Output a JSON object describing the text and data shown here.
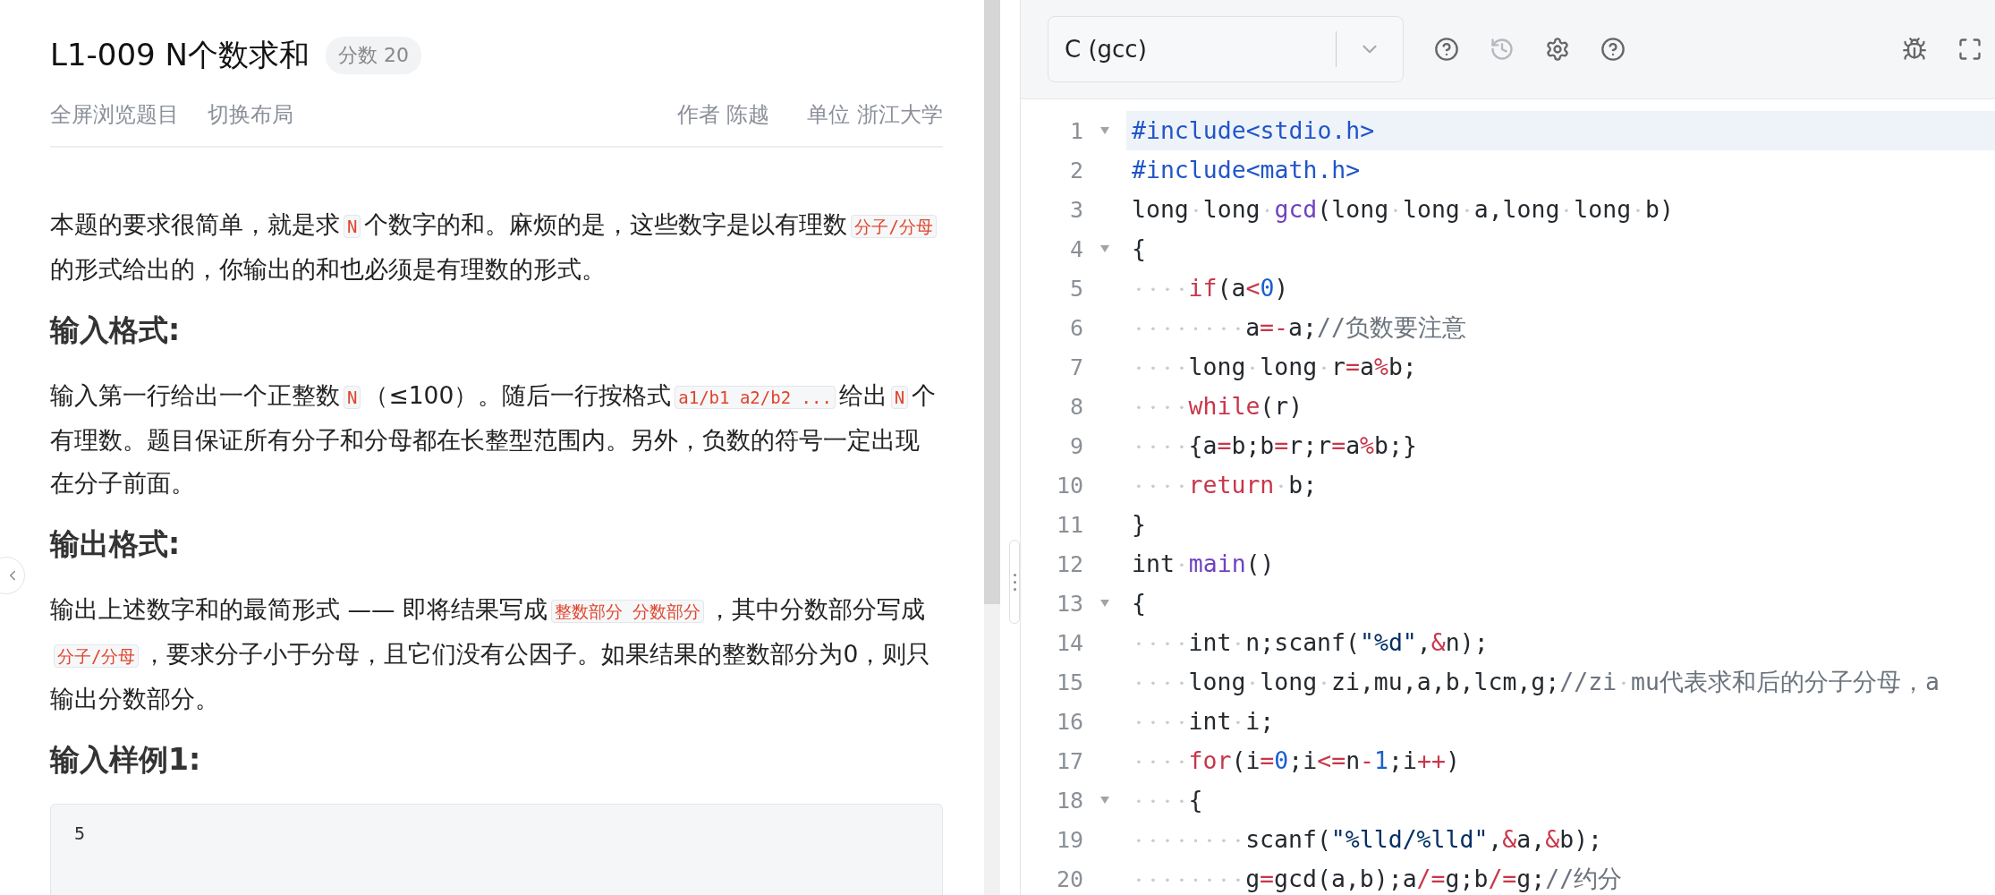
{
  "problem": {
    "title": "L1-009 N个数求和",
    "score_badge": "分数 20",
    "actions": [
      "全屏浏览题目",
      "切换布局"
    ],
    "meta": [
      "作者 陈越",
      "单位 浙江大学"
    ],
    "sections": [
      {
        "kind": "paragraph",
        "segments": [
          {
            "kind": "text",
            "text": "本题的要求很简单，就是求"
          },
          {
            "kind": "code",
            "text": "N"
          },
          {
            "kind": "text",
            "text": "个数字的和。麻烦的是，这些数字是以有理数"
          },
          {
            "kind": "code",
            "text": "分子/分母"
          },
          {
            "kind": "text",
            "text": "的形式给出的，你输出的和也必须是有理数的形式。"
          }
        ]
      },
      {
        "kind": "heading",
        "text": "输入格式:"
      },
      {
        "kind": "paragraph",
        "segments": [
          {
            "kind": "text",
            "text": "输入第一行给出一个正整数"
          },
          {
            "kind": "code",
            "text": "N"
          },
          {
            "kind": "text",
            "text": "（≤100）。随后一行按格式"
          },
          {
            "kind": "code",
            "text": "a1/b1 a2/b2 ..."
          },
          {
            "kind": "text",
            "text": "给出"
          },
          {
            "kind": "code",
            "text": "N"
          },
          {
            "kind": "text",
            "text": "个有理数。题目保证所有分子和分母都在长整型范围内。另外，负数的符号一定出现在分子前面。"
          }
        ]
      },
      {
        "kind": "heading",
        "text": "输出格式:"
      },
      {
        "kind": "paragraph",
        "segments": [
          {
            "kind": "text",
            "text": "输出上述数字和的最简形式 —— 即将结果写成"
          },
          {
            "kind": "code",
            "text": "整数部分 分数部分"
          },
          {
            "kind": "text",
            "text": "，其中分数部分写成"
          },
          {
            "kind": "code",
            "text": "分子/分母"
          },
          {
            "kind": "text",
            "text": "，要求分子小于分母，且它们没有公因子。如果结果的整数部分为0，则只输出分数部分。"
          }
        ]
      },
      {
        "kind": "heading",
        "text": "输入样例1:"
      },
      {
        "kind": "sample",
        "lines": [
          "5"
        ]
      }
    ]
  },
  "editor": {
    "language": "C (gcc)",
    "lines": [
      {
        "number": "1",
        "fold": true,
        "active": true,
        "tokens": [
          {
            "kind": "meta",
            "t": "#include<stdio.h>"
          }
        ]
      },
      {
        "number": "2",
        "fold": false,
        "active": false,
        "tokens": [
          {
            "kind": "meta",
            "t": "#include<math.h>"
          }
        ]
      },
      {
        "number": "3",
        "fold": false,
        "active": false,
        "tokens": [
          {
            "kind": "plain",
            "t": "long long "
          },
          {
            "kind": "fn",
            "t": "gcd"
          },
          {
            "kind": "plain",
            "t": "(long long a,long long b)"
          }
        ]
      },
      {
        "number": "4",
        "fold": true,
        "active": false,
        "tokens": [
          {
            "kind": "plain",
            "t": "{"
          }
        ]
      },
      {
        "number": "5",
        "fold": false,
        "active": false,
        "tokens": [
          {
            "kind": "kw",
            "t": "    if"
          },
          {
            "kind": "plain",
            "t": "(a"
          },
          {
            "kind": "op",
            "t": "<"
          },
          {
            "kind": "num",
            "t": "0"
          },
          {
            "kind": "plain",
            "t": ")"
          }
        ]
      },
      {
        "number": "6",
        "fold": false,
        "active": false,
        "tokens": [
          {
            "kind": "plain",
            "t": "        a"
          },
          {
            "kind": "op",
            "t": "=-"
          },
          {
            "kind": "plain",
            "t": "a;"
          },
          {
            "kind": "cmt",
            "t": "//负数要注意"
          }
        ]
      },
      {
        "number": "7",
        "fold": false,
        "active": false,
        "tokens": [
          {
            "kind": "plain",
            "t": "    long long r"
          },
          {
            "kind": "op",
            "t": "="
          },
          {
            "kind": "plain",
            "t": "a"
          },
          {
            "kind": "op",
            "t": "%"
          },
          {
            "kind": "plain",
            "t": "b;"
          }
        ]
      },
      {
        "number": "8",
        "fold": false,
        "active": false,
        "tokens": [
          {
            "kind": "kw",
            "t": "    while"
          },
          {
            "kind": "plain",
            "t": "(r)"
          }
        ]
      },
      {
        "number": "9",
        "fold": false,
        "active": false,
        "tokens": [
          {
            "kind": "plain",
            "t": "    {a"
          },
          {
            "kind": "op",
            "t": "="
          },
          {
            "kind": "plain",
            "t": "b;b"
          },
          {
            "kind": "op",
            "t": "="
          },
          {
            "kind": "plain",
            "t": "r;r"
          },
          {
            "kind": "op",
            "t": "="
          },
          {
            "kind": "plain",
            "t": "a"
          },
          {
            "kind": "op",
            "t": "%"
          },
          {
            "kind": "plain",
            "t": "b;}"
          }
        ]
      },
      {
        "number": "10",
        "fold": false,
        "active": false,
        "tokens": [
          {
            "kind": "kw",
            "t": "    return"
          },
          {
            "kind": "plain",
            "t": " b;"
          }
        ]
      },
      {
        "number": "11",
        "fold": false,
        "active": false,
        "tokens": [
          {
            "kind": "plain",
            "t": "}"
          }
        ]
      },
      {
        "number": "12",
        "fold": false,
        "active": false,
        "tokens": [
          {
            "kind": "plain",
            "t": "int "
          },
          {
            "kind": "fn",
            "t": "main"
          },
          {
            "kind": "plain",
            "t": "()"
          }
        ]
      },
      {
        "number": "13",
        "fold": true,
        "active": false,
        "tokens": [
          {
            "kind": "plain",
            "t": "{"
          }
        ]
      },
      {
        "number": "14",
        "fold": false,
        "active": false,
        "tokens": [
          {
            "kind": "plain",
            "t": "    int n;scanf("
          },
          {
            "kind": "str",
            "t": "\"%d\""
          },
          {
            "kind": "plain",
            "t": ","
          },
          {
            "kind": "op",
            "t": "&"
          },
          {
            "kind": "plain",
            "t": "n);"
          }
        ]
      },
      {
        "number": "15",
        "fold": false,
        "active": false,
        "tokens": [
          {
            "kind": "plain",
            "t": "    long long zi,mu,a,b,lcm,g;"
          },
          {
            "kind": "cmt",
            "t": "//zi mu代表求和后的分子分母，a"
          }
        ]
      },
      {
        "number": "16",
        "fold": false,
        "active": false,
        "tokens": [
          {
            "kind": "plain",
            "t": "    int i;"
          }
        ]
      },
      {
        "number": "17",
        "fold": false,
        "active": false,
        "tokens": [
          {
            "kind": "kw",
            "t": "    for"
          },
          {
            "kind": "plain",
            "t": "(i"
          },
          {
            "kind": "op",
            "t": "="
          },
          {
            "kind": "num",
            "t": "0"
          },
          {
            "kind": "plain",
            "t": ";i"
          },
          {
            "kind": "op",
            "t": "<="
          },
          {
            "kind": "plain",
            "t": "n"
          },
          {
            "kind": "op",
            "t": "-"
          },
          {
            "kind": "num",
            "t": "1"
          },
          {
            "kind": "plain",
            "t": ";i"
          },
          {
            "kind": "op",
            "t": "++"
          },
          {
            "kind": "plain",
            "t": ")"
          }
        ]
      },
      {
        "number": "18",
        "fold": true,
        "active": false,
        "tokens": [
          {
            "kind": "plain",
            "t": "    {"
          }
        ]
      },
      {
        "number": "19",
        "fold": false,
        "active": false,
        "tokens": [
          {
            "kind": "plain",
            "t": "        scanf("
          },
          {
            "kind": "str",
            "t": "\"%lld/%lld\""
          },
          {
            "kind": "plain",
            "t": ","
          },
          {
            "kind": "op",
            "t": "&"
          },
          {
            "kind": "plain",
            "t": "a,"
          },
          {
            "kind": "op",
            "t": "&"
          },
          {
            "kind": "plain",
            "t": "b);"
          }
        ]
      },
      {
        "number": "20",
        "fold": false,
        "active": false,
        "tokens": [
          {
            "kind": "plain",
            "t": "        g"
          },
          {
            "kind": "op",
            "t": "="
          },
          {
            "kind": "plain",
            "t": "gcd(a,b);a"
          },
          {
            "kind": "op",
            "t": "/="
          },
          {
            "kind": "plain",
            "t": "g;b"
          },
          {
            "kind": "op",
            "t": "/="
          },
          {
            "kind": "plain",
            "t": "g;"
          },
          {
            "kind": "cmt",
            "t": "//约分"
          }
        ]
      }
    ]
  }
}
